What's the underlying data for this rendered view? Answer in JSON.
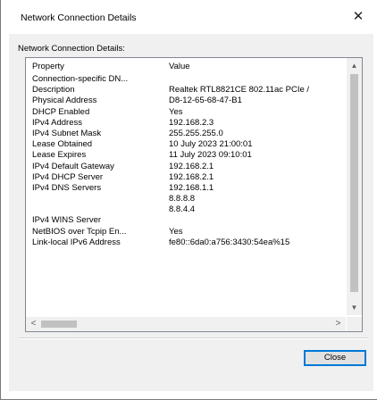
{
  "window": {
    "title": "Network Connection Details"
  },
  "group": {
    "label": "Network Connection Details:"
  },
  "table": {
    "headers": {
      "property": "Property",
      "value": "Value"
    },
    "rows": [
      {
        "property": "Connection-specific DN...",
        "value": ""
      },
      {
        "property": "Description",
        "value": "Realtek RTL8821CE 802.11ac PCIe /"
      },
      {
        "property": "Physical Address",
        "value": "D8-12-65-68-47-B1"
      },
      {
        "property": "DHCP Enabled",
        "value": "Yes"
      },
      {
        "property": "IPv4 Address",
        "value": "192.168.2.3"
      },
      {
        "property": "IPv4 Subnet Mask",
        "value": "255.255.255.0"
      },
      {
        "property": "Lease Obtained",
        "value": "10 July 2023 21:00:01"
      },
      {
        "property": "Lease Expires",
        "value": "11 July 2023 09:10:01"
      },
      {
        "property": "IPv4 Default Gateway",
        "value": "192.168.2.1"
      },
      {
        "property": "IPv4 DHCP Server",
        "value": "192.168.2.1"
      },
      {
        "property": "IPv4 DNS Servers",
        "value": "192.168.1.1"
      },
      {
        "property": "",
        "value": "8.8.8.8"
      },
      {
        "property": "",
        "value": "8.8.4.4"
      },
      {
        "property": "IPv4 WINS Server",
        "value": ""
      },
      {
        "property": "NetBIOS over Tcpip En...",
        "value": "Yes"
      },
      {
        "property": "Link-local IPv6 Address",
        "value": "fe80::6da0:a756:3430:54ea%15"
      }
    ]
  },
  "scrollbars": {
    "up_icon": "chevron-up-icon",
    "down_icon": "chevron-down-icon",
    "left_icon": "chevron-left-icon",
    "right_icon": "chevron-right-icon"
  },
  "buttons": {
    "close_label": "Close"
  },
  "colors": {
    "accent": "#0078d7"
  }
}
